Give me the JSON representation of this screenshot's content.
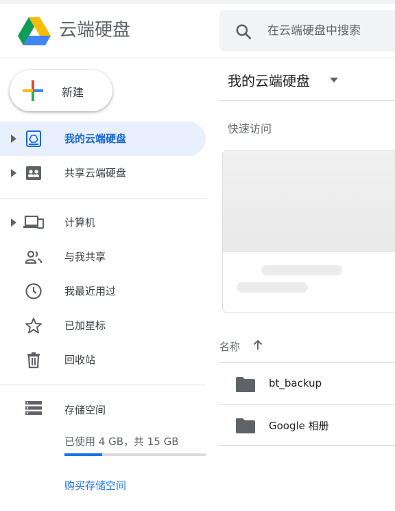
{
  "app": {
    "title": "云端硬盘",
    "logo": "google-drive-logo"
  },
  "search": {
    "placeholder": "在云端硬盘中搜索",
    "icon": "search-icon"
  },
  "new_button": {
    "label": "新建",
    "icon": "plus-icon"
  },
  "sidebar": {
    "items": [
      {
        "label": "我的云端硬盘",
        "icon": "my-drive-icon",
        "active": true,
        "expandable": true
      },
      {
        "label": "共享云端硬盘",
        "icon": "shared-drives-icon",
        "active": false,
        "expandable": true
      },
      {
        "label": "计算机",
        "icon": "computers-icon",
        "active": false,
        "expandable": true
      },
      {
        "label": "与我共享",
        "icon": "shared-with-me-icon",
        "active": false,
        "expandable": false
      },
      {
        "label": "我最近用过",
        "icon": "recent-clock-icon",
        "active": false,
        "expandable": false
      },
      {
        "label": "已加星标",
        "icon": "star-icon",
        "active": false,
        "expandable": false
      },
      {
        "label": "回收站",
        "icon": "trash-icon",
        "active": false,
        "expandable": false
      }
    ]
  },
  "storage": {
    "label": "存储空间",
    "used_text": "已使用 4 GB，共 15 GB",
    "used_fraction": 0.2667,
    "buy_label": "购买存储空间",
    "icon": "storage-icon"
  },
  "main": {
    "title": "我的云端硬盘",
    "quick_access_label": "快速访问",
    "column_name": "名称",
    "files": [
      {
        "name": "bt_backup",
        "type": "folder"
      },
      {
        "name": "Google 相册",
        "type": "folder"
      }
    ]
  },
  "colors": {
    "accent": "#1a73e8",
    "active_bg": "#e8f0fe",
    "active_text": "#1967d2",
    "icon_gray": "#5f6368",
    "folder_gray": "#5f6368"
  }
}
